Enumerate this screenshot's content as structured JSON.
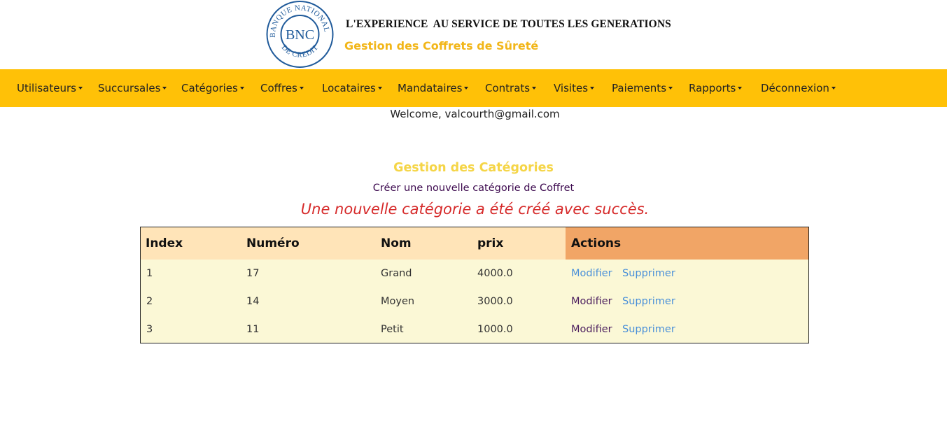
{
  "header": {
    "logo": {
      "top_text": "BANQUE NATIONALE",
      "center_text": "BNC",
      "bottom_text": "DE CREDIT"
    },
    "slogan": "L'EXPERIENCE  AU SERVICE DE TOUTES LES GENERATIONS",
    "subtitle": "Gestion des Coffrets de Sûreté"
  },
  "nav": {
    "items": [
      {
        "label": "Utilisateurs"
      },
      {
        "label": "Succursales"
      },
      {
        "label": "Catégories"
      },
      {
        "label": "Coffres"
      },
      {
        "label": "Locataires"
      },
      {
        "label": "Mandataires"
      },
      {
        "label": "Contrats"
      },
      {
        "label": "Visites"
      },
      {
        "label": "Paiements"
      },
      {
        "label": "Rapports"
      },
      {
        "label": "Déconnexion"
      }
    ]
  },
  "welcome": "Welcome, valcourth@gmail.com",
  "main": {
    "title": "Gestion des Catégories",
    "create_link": "Créer une nouvelle catégorie de Coffret",
    "success_message": "Une nouvelle catégorie a été créé avec succès."
  },
  "table": {
    "headers": [
      "Index",
      "Numéro",
      "Nom",
      "prix",
      "Actions"
    ],
    "rows": [
      {
        "index": "1",
        "numero": "17",
        "nom": "Grand",
        "prix": "4000.0",
        "modifier": "Modifier",
        "supprimer": "Supprimer"
      },
      {
        "index": "2",
        "numero": "14",
        "nom": "Moyen",
        "prix": "3000.0",
        "modifier": "Modifier",
        "supprimer": "Supprimer"
      },
      {
        "index": "3",
        "numero": "11",
        "nom": "Petit",
        "prix": "1000.0",
        "modifier": "Modifier",
        "supprimer": "Supprimer"
      }
    ]
  },
  "colors": {
    "nav_bg": "#ffc107",
    "subtitle": "#f2b619",
    "page_title": "#f5d547",
    "success": "#d62a2a",
    "table_header": "#ffe4b8",
    "actions_header": "#f1a566",
    "table_body": "#fbf8d6",
    "link_blue": "#4a90d9",
    "link_purple": "#4b1e5e",
    "logo_blue": "#1f5a9a"
  }
}
